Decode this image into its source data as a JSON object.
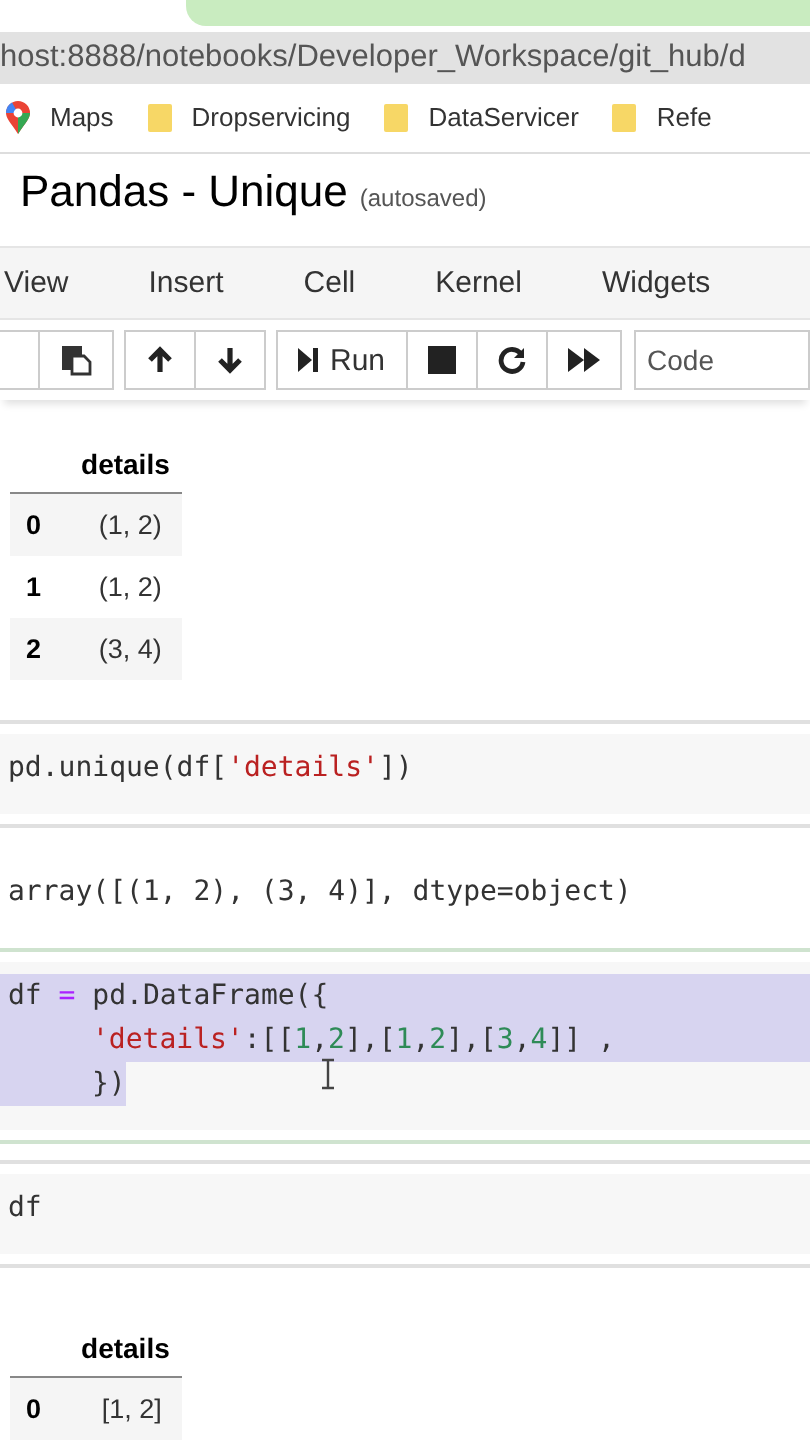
{
  "address_bar": {
    "url": "host:8888/notebooks/Developer_Workspace/git_hub/d"
  },
  "bookmarks": [
    {
      "label": "Maps",
      "kind": "maps"
    },
    {
      "label": "Dropservicing",
      "kind": "folder"
    },
    {
      "label": "DataServicer",
      "kind": "folder"
    },
    {
      "label": "Refe",
      "kind": "folder"
    }
  ],
  "notebook": {
    "title": "Pandas - Unique",
    "status": "(autosaved)"
  },
  "menu": [
    "View",
    "Insert",
    "Cell",
    "Kernel",
    "Widgets"
  ],
  "toolbar": {
    "run_label": "Run",
    "cell_type": "Code"
  },
  "cells": [
    {
      "kind": "table",
      "header": "details",
      "rows": [
        {
          "index": "0",
          "value": "(1, 2)"
        },
        {
          "index": "1",
          "value": "(1, 2)"
        },
        {
          "index": "2",
          "value": "(3, 4)"
        }
      ]
    },
    {
      "kind": "input",
      "selected": false,
      "lines": [
        {
          "highlighted": false,
          "indented": false,
          "tokens": [
            {
              "kind": "plain",
              "text": "pd.unique(df["
            },
            {
              "kind": "string",
              "text": "'details'"
            },
            {
              "kind": "plain",
              "text": "])"
            }
          ]
        }
      ]
    },
    {
      "kind": "output",
      "text": "array([(1, 2), (3, 4)], dtype=object)"
    },
    {
      "kind": "input",
      "selected": true,
      "lines": [
        {
          "highlighted": true,
          "indented": false,
          "tokens": [
            {
              "kind": "plain",
              "text": "df "
            },
            {
              "kind": "operator",
              "text": "="
            },
            {
              "kind": "plain",
              "text": " pd.DataFrame({"
            }
          ]
        },
        {
          "highlighted": true,
          "indented": true,
          "tokens": [
            {
              "kind": "string",
              "text": "'details'"
            },
            {
              "kind": "plain",
              "text": ":[["
            },
            {
              "kind": "number",
              "text": "1"
            },
            {
              "kind": "plain",
              "text": ","
            },
            {
              "kind": "number",
              "text": "2"
            },
            {
              "kind": "plain",
              "text": "],["
            },
            {
              "kind": "number",
              "text": "1"
            },
            {
              "kind": "plain",
              "text": ","
            },
            {
              "kind": "number",
              "text": "2"
            },
            {
              "kind": "plain",
              "text": "],["
            },
            {
              "kind": "number",
              "text": "3"
            },
            {
              "kind": "plain",
              "text": ","
            },
            {
              "kind": "number",
              "text": "4"
            },
            {
              "kind": "plain",
              "text": "]] ,"
            }
          ]
        },
        {
          "highlighted": true,
          "indented": true,
          "tokens": [
            {
              "kind": "plain",
              "text": "})"
            }
          ]
        }
      ]
    },
    {
      "kind": "input",
      "selected": false,
      "lines": [
        {
          "highlighted": false,
          "indented": false,
          "tokens": [
            {
              "kind": "plain",
              "text": "df"
            }
          ]
        }
      ]
    },
    {
      "kind": "table",
      "header": "details",
      "rows": [
        {
          "index": "0",
          "value": "[1, 2]"
        }
      ]
    }
  ]
}
